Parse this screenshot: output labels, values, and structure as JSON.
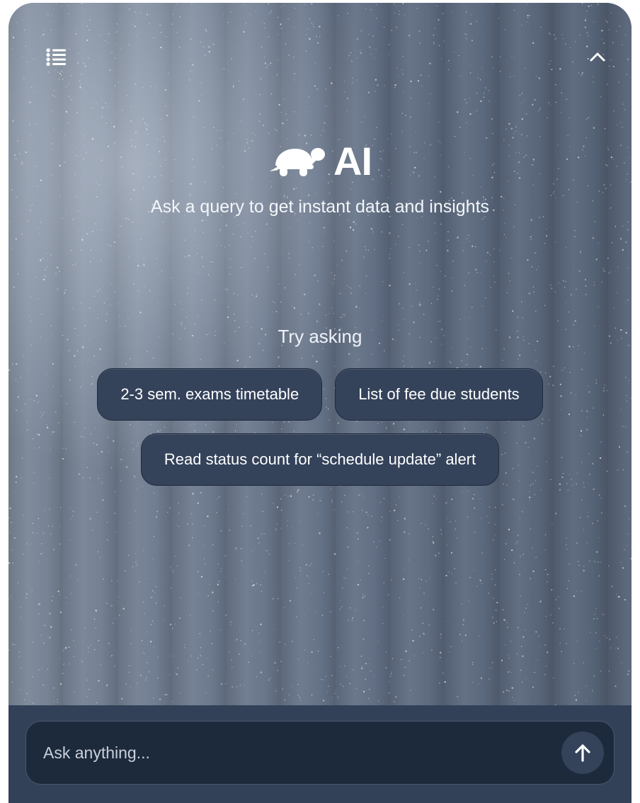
{
  "header": {
    "history_icon": "list-icon",
    "collapse_icon": "chevron-up-icon"
  },
  "hero": {
    "logo_icon": "turtle-icon",
    "title": "AI",
    "subtitle": "Ask a query to get instant data and insights"
  },
  "suggestions": {
    "label": "Try asking",
    "items": [
      "2-3 sem. exams timetable",
      "List of fee due students",
      "Read status count for “schedule update” alert"
    ]
  },
  "composer": {
    "placeholder": "Ask anything...",
    "send_icon": "arrow-up-icon"
  },
  "colors": {
    "chip_bg": "#34425a",
    "footer_bg": "#334158",
    "input_bg": "#1d2a3c",
    "text": "#ffffff"
  }
}
